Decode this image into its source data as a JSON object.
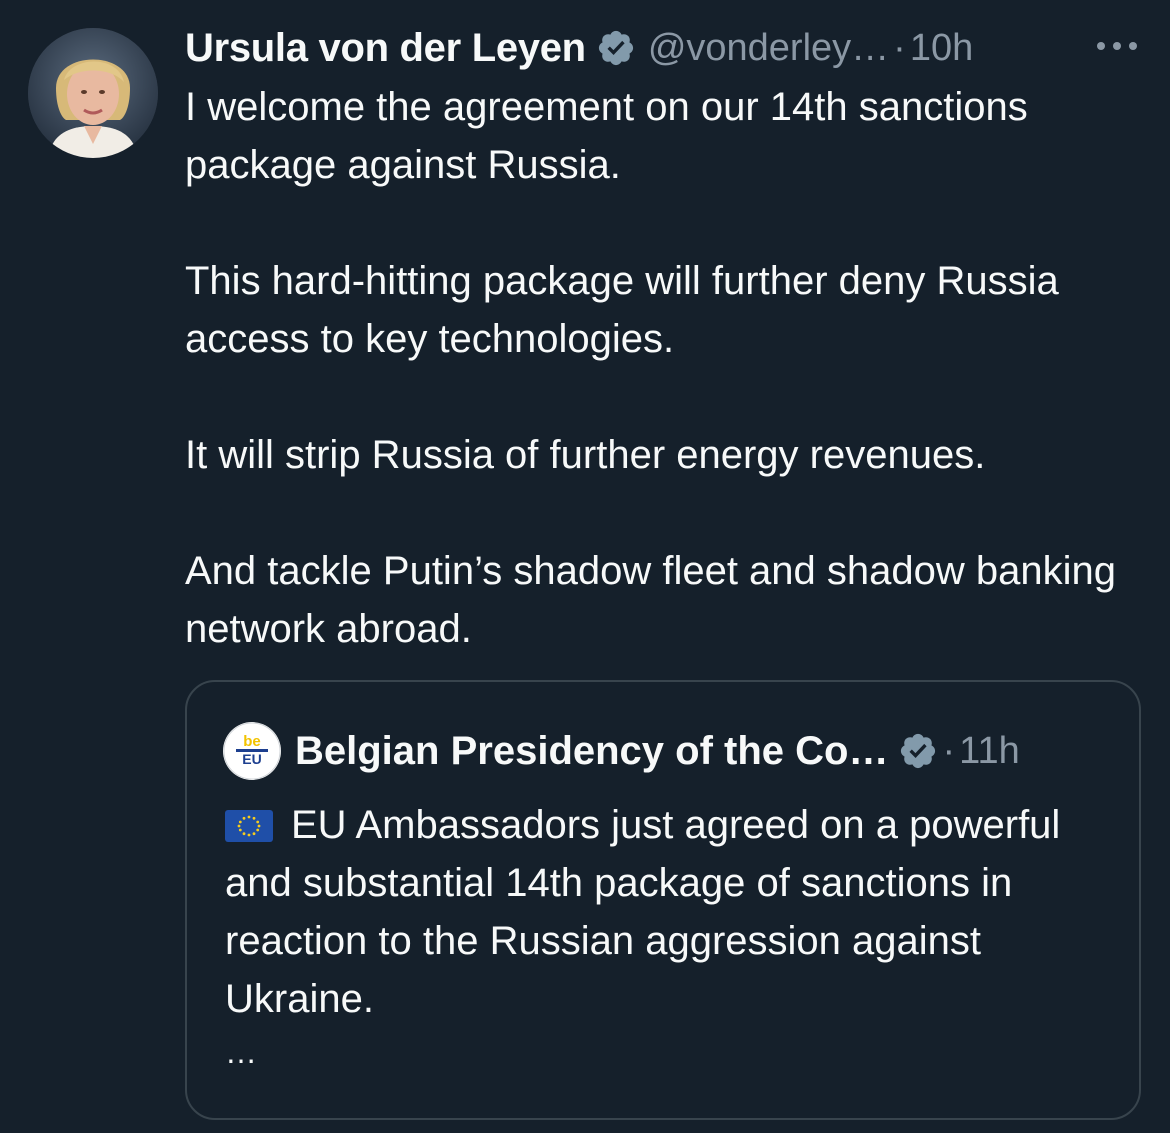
{
  "tweet": {
    "author_name": "Ursula von der Leyen",
    "handle": "@vonderley…",
    "separator": "·",
    "time": "10h",
    "paragraphs": [
      "I welcome the agreement on our 14th sanctions package against Russia.",
      "This hard-hitting package will further deny Russia access to key technologies.",
      "It will strip Russia of further energy revenues.",
      "And tackle Putin’s shadow fleet and shadow banking network abroad."
    ],
    "verified_icon": "verified-badge-icon",
    "more_icon": "more-options-icon"
  },
  "quote": {
    "author_name": "Belgian Presidency of the Co…",
    "separator": "·",
    "time": "11h",
    "avatar_text_top": "be",
    "avatar_text_main": "EU",
    "flag_icon": "eu-flag-emoji",
    "text": "EU Ambassadors just agreed on a powerful and substantial 14th package of sanctions in reaction to the Russian aggression against Ukraine.",
    "ellipsis": "…"
  },
  "colors": {
    "background": "#15202b",
    "text": "#f7f9f9",
    "muted": "#8b98a5",
    "border": "#38444d",
    "verified_badge": "#829aab"
  }
}
